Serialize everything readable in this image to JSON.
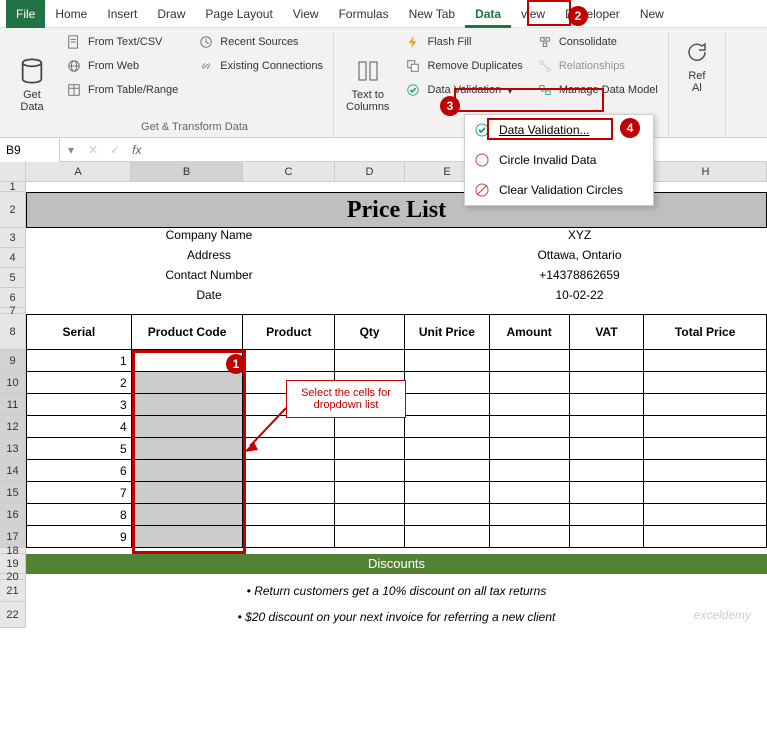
{
  "tabs": {
    "file": "File",
    "home": "Home",
    "insert": "Insert",
    "draw": "Draw",
    "pagelayout": "Page Layout",
    "view": "View",
    "formulas": "Formulas",
    "newtab": "New Tab",
    "data": "Data",
    "review": "view",
    "developer": "Developer",
    "new": "New"
  },
  "ribbon": {
    "getdata": "Get\nData",
    "from_text": "From Text/CSV",
    "from_web": "From Web",
    "from_table": "From Table/Range",
    "recent": "Recent Sources",
    "existing": "Existing Connections",
    "group_get": "Get & Transform Data",
    "text_to_cols": "Text to\nColumns",
    "flashfill": "Flash Fill",
    "dupes": "Remove Duplicates",
    "validation": "Data Validation",
    "consolidate": "Consolidate",
    "relationships": "Relationships",
    "model": "Manage Data Model",
    "refresh": "Ref\nAl"
  },
  "validation_menu": {
    "validation": "Data Validation...",
    "circle": "Circle Invalid Data",
    "clear": "Clear Validation Circles"
  },
  "namebox": "B9",
  "fx": "fx",
  "columns": [
    "A",
    "B",
    "C",
    "D",
    "E",
    "F",
    "G",
    "H"
  ],
  "sheet": {
    "title": "Price List",
    "info": {
      "company_lbl": "Company Name",
      "company_val": "XYZ",
      "address_lbl": "Address",
      "address_val": "Ottawa, Ontario",
      "contact_lbl": "Contact Number",
      "contact_val": "+14378862659",
      "date_lbl": "Date",
      "date_val": "10-02-22"
    },
    "headers": {
      "serial": "Serial",
      "code": "Product Code",
      "product": "Product",
      "qty": "Qty",
      "unit": "Unit Price",
      "amount": "Amount",
      "vat": "VAT",
      "total": "Total Price"
    },
    "serials": [
      "1",
      "2",
      "3",
      "4",
      "5",
      "6",
      "7",
      "8",
      "9"
    ],
    "discounts_hdr": "Discounts",
    "discount1": "• Return customers get a 10% discount on all tax returns",
    "discount2": "• $20 discount on your next invoice for referring a new client"
  },
  "callouts": {
    "step1": "1",
    "step2": "2",
    "step3": "3",
    "step4": "4",
    "select_text": "Select the cells for dropdown list"
  },
  "watermark": "exceldemy"
}
